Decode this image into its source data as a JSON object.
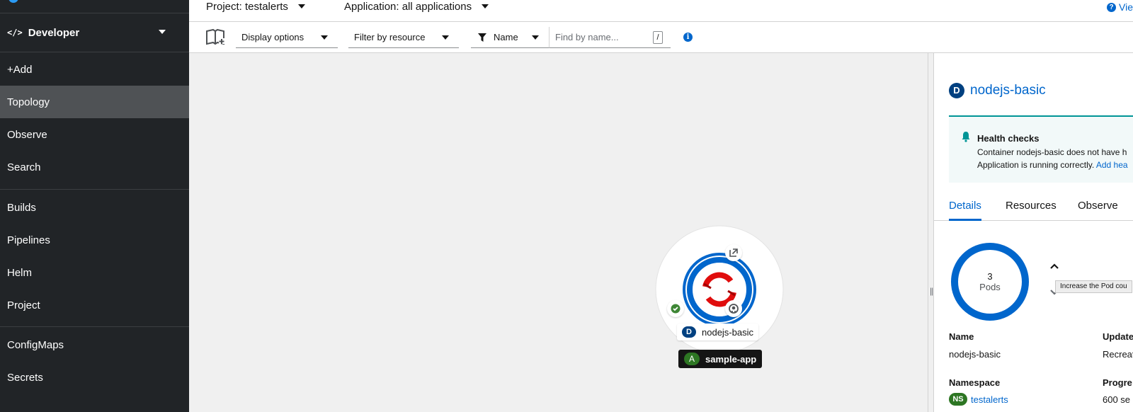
{
  "sidebar": {
    "perspective": {
      "icon": "code-icon",
      "label": "Developer"
    },
    "group1": [
      {
        "label": "+Add"
      },
      {
        "label": "Topology",
        "active": true
      },
      {
        "label": "Observe"
      },
      {
        "label": "Search"
      }
    ],
    "group2": [
      {
        "label": "Builds"
      },
      {
        "label": "Pipelines"
      },
      {
        "label": "Helm"
      },
      {
        "label": "Project"
      }
    ],
    "group3": [
      {
        "label": "ConfigMaps"
      },
      {
        "label": "Secrets"
      }
    ]
  },
  "topbar": {
    "project": "Project: testalerts",
    "application": "Application: all applications",
    "help_link": "Vie"
  },
  "toolbar": {
    "display_options": "Display options",
    "filter_by_resource": "Filter by resource",
    "filter_type": "Name",
    "find_placeholder": "Find by name...",
    "slash": "/"
  },
  "topology": {
    "deployment": {
      "badge": "D",
      "name": "nodejs-basic"
    },
    "application": {
      "badge": "A",
      "name": "sample-app"
    }
  },
  "side_panel": {
    "resource_badge": "D",
    "resource_name": "nodejs-basic",
    "alert": {
      "title": "Health checks",
      "line1": "Container nodejs-basic does not have h",
      "line2": "Application is running correctly.",
      "link": "Add hea"
    },
    "tabs": [
      {
        "label": "Details",
        "active": true
      },
      {
        "label": "Resources"
      },
      {
        "label": "Observe"
      }
    ],
    "pods": {
      "count": "3",
      "label": "Pods"
    },
    "tooltip": "Increase the Pod cou",
    "details": {
      "name_label": "Name",
      "name_value": "nodejs-basic",
      "update_label": "Update",
      "update_value": "Recreat",
      "namespace_label": "Namespace",
      "namespace_badge": "NS",
      "namespace_value": "testalerts",
      "progress_label": "Progre",
      "progress_value": "600 se"
    }
  },
  "colors": {
    "sidebar_bg": "#212427",
    "active_nav_bg": "#4f5255",
    "link_blue": "#0066cc",
    "deployment_badge": "#004080",
    "app_badge": "#2d7623",
    "alert_teal": "#009596",
    "openshift_red": "#e00d0d"
  }
}
